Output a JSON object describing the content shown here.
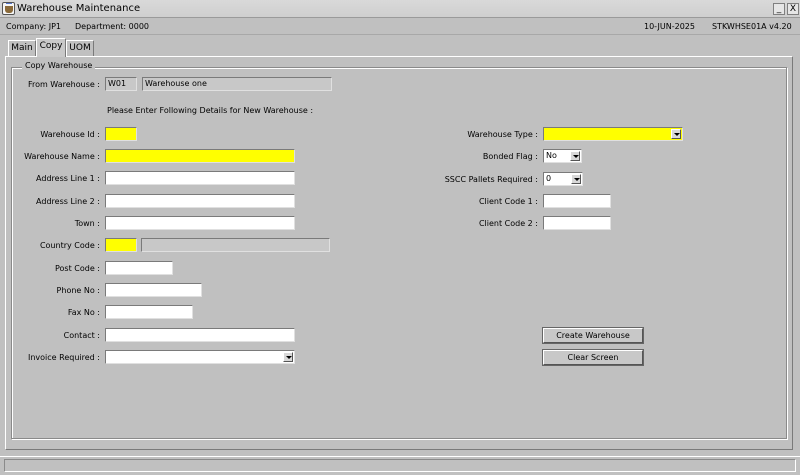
{
  "window": {
    "title": "Warehouse Maintenance",
    "minimize_glyph": "_",
    "close_glyph": "X"
  },
  "info": {
    "company": "Company:  JP1",
    "department": "Department:  0000",
    "date": "10-JUN-2025",
    "program": "STKWHSE01A  v4.20"
  },
  "tabs": [
    {
      "label": "Main"
    },
    {
      "label": "Copy",
      "active": true
    },
    {
      "label": "UOM"
    }
  ],
  "group_title": "Copy Warehouse",
  "from_warehouse": {
    "label": "From Warehouse :",
    "code": "W01",
    "name": "Warehouse one"
  },
  "instruction": "Please Enter Following Details for New Warehouse :",
  "left_fields": {
    "warehouse_id": {
      "label": "Warehouse Id :",
      "value": ""
    },
    "warehouse_name": {
      "label": "Warehouse Name :",
      "value": ""
    },
    "address_line_1": {
      "label": "Address Line 1 :",
      "value": ""
    },
    "address_line_2": {
      "label": "Address Line 2 :",
      "value": ""
    },
    "town": {
      "label": "Town :",
      "value": ""
    },
    "country_code": {
      "label": "Country Code :",
      "value": "",
      "description": ""
    },
    "post_code": {
      "label": "Post Code :",
      "value": ""
    },
    "phone_no": {
      "label": "Phone No :",
      "value": ""
    },
    "fax_no": {
      "label": "Fax No :",
      "value": ""
    },
    "contact": {
      "label": "Contact :",
      "value": ""
    },
    "invoice_required": {
      "label": "Invoice Required :",
      "value": ""
    }
  },
  "right_fields": {
    "warehouse_type": {
      "label": "Warehouse Type :",
      "value": ""
    },
    "bonded_flag": {
      "label": "Bonded Flag :",
      "value": "No"
    },
    "sscc_pallets_required": {
      "label": "SSCC Pallets Required :",
      "value": "0"
    },
    "client_code_1": {
      "label": "Client Code 1 :",
      "value": ""
    },
    "client_code_2": {
      "label": "Client Code 2 :",
      "value": ""
    }
  },
  "buttons": {
    "create_warehouse": "Create Warehouse",
    "clear_screen": "Clear Screen"
  },
  "colors": {
    "required_field": "#ffff00",
    "window_background": "#c0c0c0"
  }
}
